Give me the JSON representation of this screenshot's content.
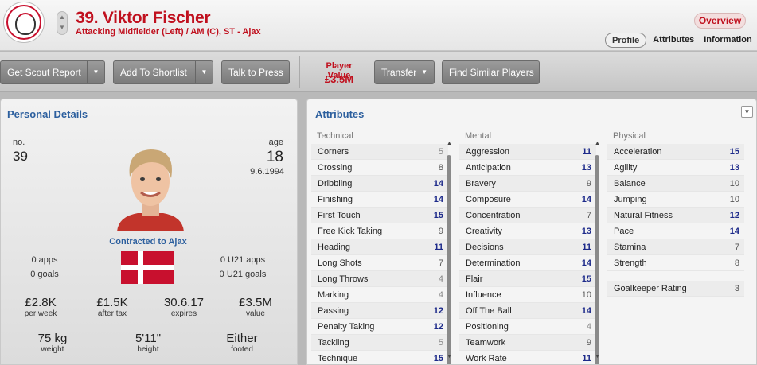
{
  "header": {
    "player_name": "39. Viktor Fischer",
    "position": "Attacking Midfielder (Left) / AM (C), ST - Ajax",
    "overview_label": "Overview",
    "tabs": [
      {
        "label": "Profile",
        "active": true
      },
      {
        "label": "Attributes",
        "active": false
      },
      {
        "label": "Information",
        "active": false
      }
    ]
  },
  "toolbar": {
    "scout_report": "Get Scout Report",
    "add_shortlist": "Add To Shortlist",
    "talk_press": "Talk to Press",
    "player_value_label": "Player Value",
    "player_value": "£3.5M",
    "transfer": "Transfer",
    "find_similar": "Find Similar Players"
  },
  "personal": {
    "title": "Personal Details",
    "no_label": "no.",
    "no_value": "39",
    "age_label": "age",
    "age_value": "18",
    "dob": "9.6.1994",
    "contract": "Contracted to Ajax",
    "apps": "0 apps",
    "goals": "0 goals",
    "u21_apps": "0 U21 apps",
    "u21_goals": "0 U21 goals",
    "wage_value": "£2.8K",
    "wage_label": "per week",
    "after_tax_value": "£1.5K",
    "after_tax_label": "after tax",
    "expires_value": "30.6.17",
    "expires_label": "expires",
    "value_value": "£3.5M",
    "value_label": "value",
    "weight_value": "75 kg",
    "weight_label": "weight",
    "height_value": "5'11\"",
    "height_label": "height",
    "foot_value": "Either",
    "foot_label": "footed"
  },
  "attributes": {
    "title": "Attributes",
    "technical": {
      "heading": "Technical",
      "items": [
        {
          "name": "Corners",
          "value": "5"
        },
        {
          "name": "Crossing",
          "value": "8"
        },
        {
          "name": "Dribbling",
          "value": "14"
        },
        {
          "name": "Finishing",
          "value": "14"
        },
        {
          "name": "First Touch",
          "value": "15"
        },
        {
          "name": "Free Kick Taking",
          "value": "9"
        },
        {
          "name": "Heading",
          "value": "11"
        },
        {
          "name": "Long Shots",
          "value": "7"
        },
        {
          "name": "Long Throws",
          "value": "4"
        },
        {
          "name": "Marking",
          "value": "4"
        },
        {
          "name": "Passing",
          "value": "12"
        },
        {
          "name": "Penalty Taking",
          "value": "12"
        },
        {
          "name": "Tackling",
          "value": "5"
        },
        {
          "name": "Technique",
          "value": "15"
        }
      ]
    },
    "mental": {
      "heading": "Mental",
      "items": [
        {
          "name": "Aggression",
          "value": "11"
        },
        {
          "name": "Anticipation",
          "value": "13"
        },
        {
          "name": "Bravery",
          "value": "9"
        },
        {
          "name": "Composure",
          "value": "14"
        },
        {
          "name": "Concentration",
          "value": "7"
        },
        {
          "name": "Creativity",
          "value": "13"
        },
        {
          "name": "Decisions",
          "value": "11"
        },
        {
          "name": "Determination",
          "value": "14"
        },
        {
          "name": "Flair",
          "value": "15"
        },
        {
          "name": "Influence",
          "value": "10"
        },
        {
          "name": "Off The Ball",
          "value": "14"
        },
        {
          "name": "Positioning",
          "value": "4"
        },
        {
          "name": "Teamwork",
          "value": "9"
        },
        {
          "name": "Work Rate",
          "value": "11"
        }
      ]
    },
    "physical": {
      "heading": "Physical",
      "items": [
        {
          "name": "Acceleration",
          "value": "15"
        },
        {
          "name": "Agility",
          "value": "13"
        },
        {
          "name": "Balance",
          "value": "10"
        },
        {
          "name": "Jumping",
          "value": "10"
        },
        {
          "name": "Natural Fitness",
          "value": "12"
        },
        {
          "name": "Pace",
          "value": "14"
        },
        {
          "name": "Stamina",
          "value": "7"
        },
        {
          "name": "Strength",
          "value": "8"
        }
      ],
      "gk_label": "Goalkeeper Rating",
      "gk_value": "3"
    }
  }
}
